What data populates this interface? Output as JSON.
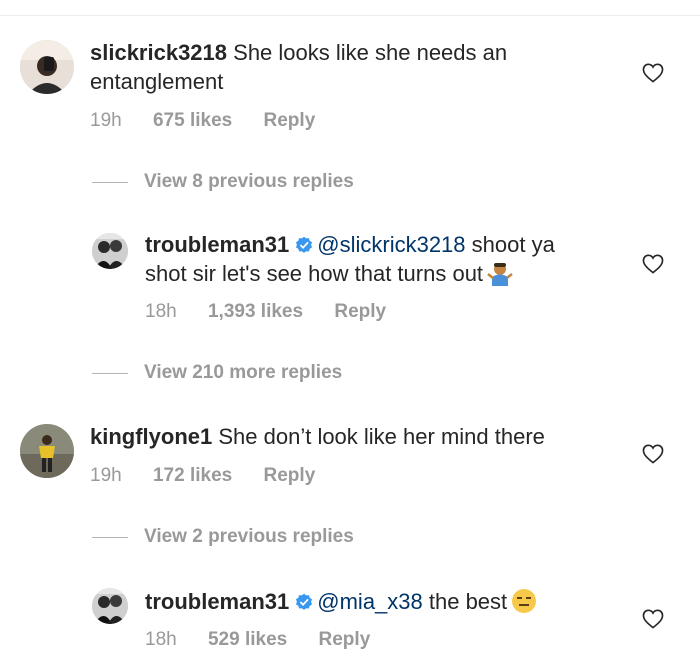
{
  "comments": [
    {
      "username": "slickrick3218",
      "text": " She looks like she needs an",
      "text2": "entanglement",
      "time": "19h",
      "likes": "675 likes",
      "reply": "Reply"
    },
    {
      "username": "troubleman31",
      "mention": "@slickrick3218",
      "text": " shoot ya",
      "text2": "shot sir let's see how that turns out",
      "time": "18h",
      "likes": "1,393 likes",
      "reply": "Reply"
    },
    {
      "username": "kingflyone1",
      "text": " She don’t look like her mind there",
      "time": "19h",
      "likes": "172 likes",
      "reply": "Reply"
    },
    {
      "username": "troubleman31",
      "mention": "@mia_x38",
      "text": " the best",
      "time": "18h",
      "likes": "529 likes",
      "reply": "Reply"
    }
  ],
  "view_replies": [
    "View 8 previous replies",
    "View 210 more replies",
    "View 2 previous replies"
  ],
  "colors": {
    "mention": "#003569",
    "meta": "#999999",
    "verified": "#3897f0"
  },
  "icons": [
    "heart-icon",
    "verified-badge-icon",
    "shrug-emoji",
    "expressionless-emoji"
  ]
}
